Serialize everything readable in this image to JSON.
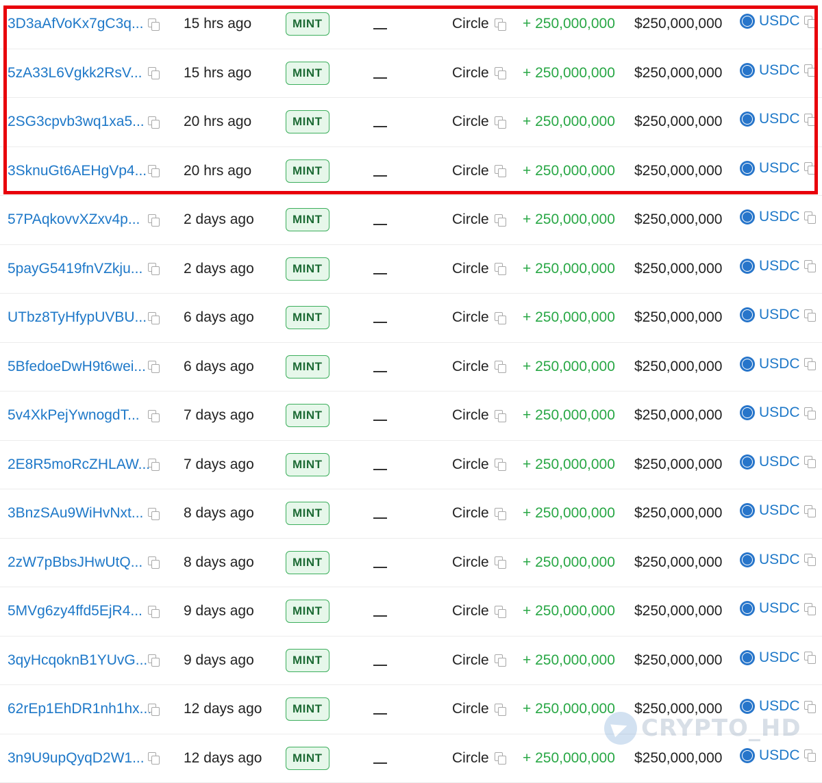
{
  "transfers": [
    {
      "signature": "3D3aAfVoKx7gC3q...",
      "time": "15 hrs ago",
      "type": "MINT",
      "to": "Circle",
      "amount": "+ 250,000,000",
      "value": "$250,000,000",
      "token": "USDC"
    },
    {
      "signature": "5zA33L6Vgkk2RsV...",
      "time": "15 hrs ago",
      "type": "MINT",
      "to": "Circle",
      "amount": "+ 250,000,000",
      "value": "$250,000,000",
      "token": "USDC"
    },
    {
      "signature": "2SG3cpvb3wq1xa5...",
      "time": "20 hrs ago",
      "type": "MINT",
      "to": "Circle",
      "amount": "+ 250,000,000",
      "value": "$250,000,000",
      "token": "USDC"
    },
    {
      "signature": "3SknuGt6AEHgVp4...",
      "time": "20 hrs ago",
      "type": "MINT",
      "to": "Circle",
      "amount": "+ 250,000,000",
      "value": "$250,000,000",
      "token": "USDC"
    },
    {
      "signature": "57PAqkovvXZxv4p...",
      "time": "2 days ago",
      "type": "MINT",
      "to": "Circle",
      "amount": "+ 250,000,000",
      "value": "$250,000,000",
      "token": "USDC"
    },
    {
      "signature": "5payG5419fnVZkju...",
      "time": "2 days ago",
      "type": "MINT",
      "to": "Circle",
      "amount": "+ 250,000,000",
      "value": "$250,000,000",
      "token": "USDC"
    },
    {
      "signature": "UTbz8TyHfypUVBU...",
      "time": "6 days ago",
      "type": "MINT",
      "to": "Circle",
      "amount": "+ 250,000,000",
      "value": "$250,000,000",
      "token": "USDC"
    },
    {
      "signature": "5BfedoeDwH9t6wei...",
      "time": "6 days ago",
      "type": "MINT",
      "to": "Circle",
      "amount": "+ 250,000,000",
      "value": "$250,000,000",
      "token": "USDC"
    },
    {
      "signature": "5v4XkPejYwnogdT...",
      "time": "7 days ago",
      "type": "MINT",
      "to": "Circle",
      "amount": "+ 250,000,000",
      "value": "$250,000,000",
      "token": "USDC"
    },
    {
      "signature": "2E8R5moRcZHLAW...",
      "time": "7 days ago",
      "type": "MINT",
      "to": "Circle",
      "amount": "+ 250,000,000",
      "value": "$250,000,000",
      "token": "USDC"
    },
    {
      "signature": "3BnzSAu9WiHvNxt...",
      "time": "8 days ago",
      "type": "MINT",
      "to": "Circle",
      "amount": "+ 250,000,000",
      "value": "$250,000,000",
      "token": "USDC"
    },
    {
      "signature": "2zW7pBbsJHwUtQ...",
      "time": "8 days ago",
      "type": "MINT",
      "to": "Circle",
      "amount": "+ 250,000,000",
      "value": "$250,000,000",
      "token": "USDC"
    },
    {
      "signature": "5MVg6zy4ffd5EjR4...",
      "time": "9 days ago",
      "type": "MINT",
      "to": "Circle",
      "amount": "+ 250,000,000",
      "value": "$250,000,000",
      "token": "USDC"
    },
    {
      "signature": "3qyHcqoknB1YUvG...",
      "time": "9 days ago",
      "type": "MINT",
      "to": "Circle",
      "amount": "+ 250,000,000",
      "value": "$250,000,000",
      "token": "USDC"
    },
    {
      "signature": "62rEp1EhDR1nh1hx...",
      "time": "12 days ago",
      "type": "MINT",
      "to": "Circle",
      "amount": "+ 250,000,000",
      "value": "$250,000,000",
      "token": "USDC"
    },
    {
      "signature": "3n9U9upQyqD2W1...",
      "time": "12 days ago",
      "type": "MINT",
      "to": "Circle",
      "amount": "+ 250,000,000",
      "value": "$250,000,000",
      "token": "USDC"
    }
  ],
  "from_placeholder": "—",
  "watermark": "CRYPTO_HD",
  "colors": {
    "link": "#1e78c8",
    "amount_positive": "#28a745",
    "badge_border": "#3cae5c",
    "badge_bg": "#e6f7ea",
    "highlight": "#e8000b",
    "usdc": "#2775ca"
  },
  "icons": {
    "copy": "copy-icon",
    "token": "usdc-coin-icon",
    "watermark": "telegram-icon"
  }
}
